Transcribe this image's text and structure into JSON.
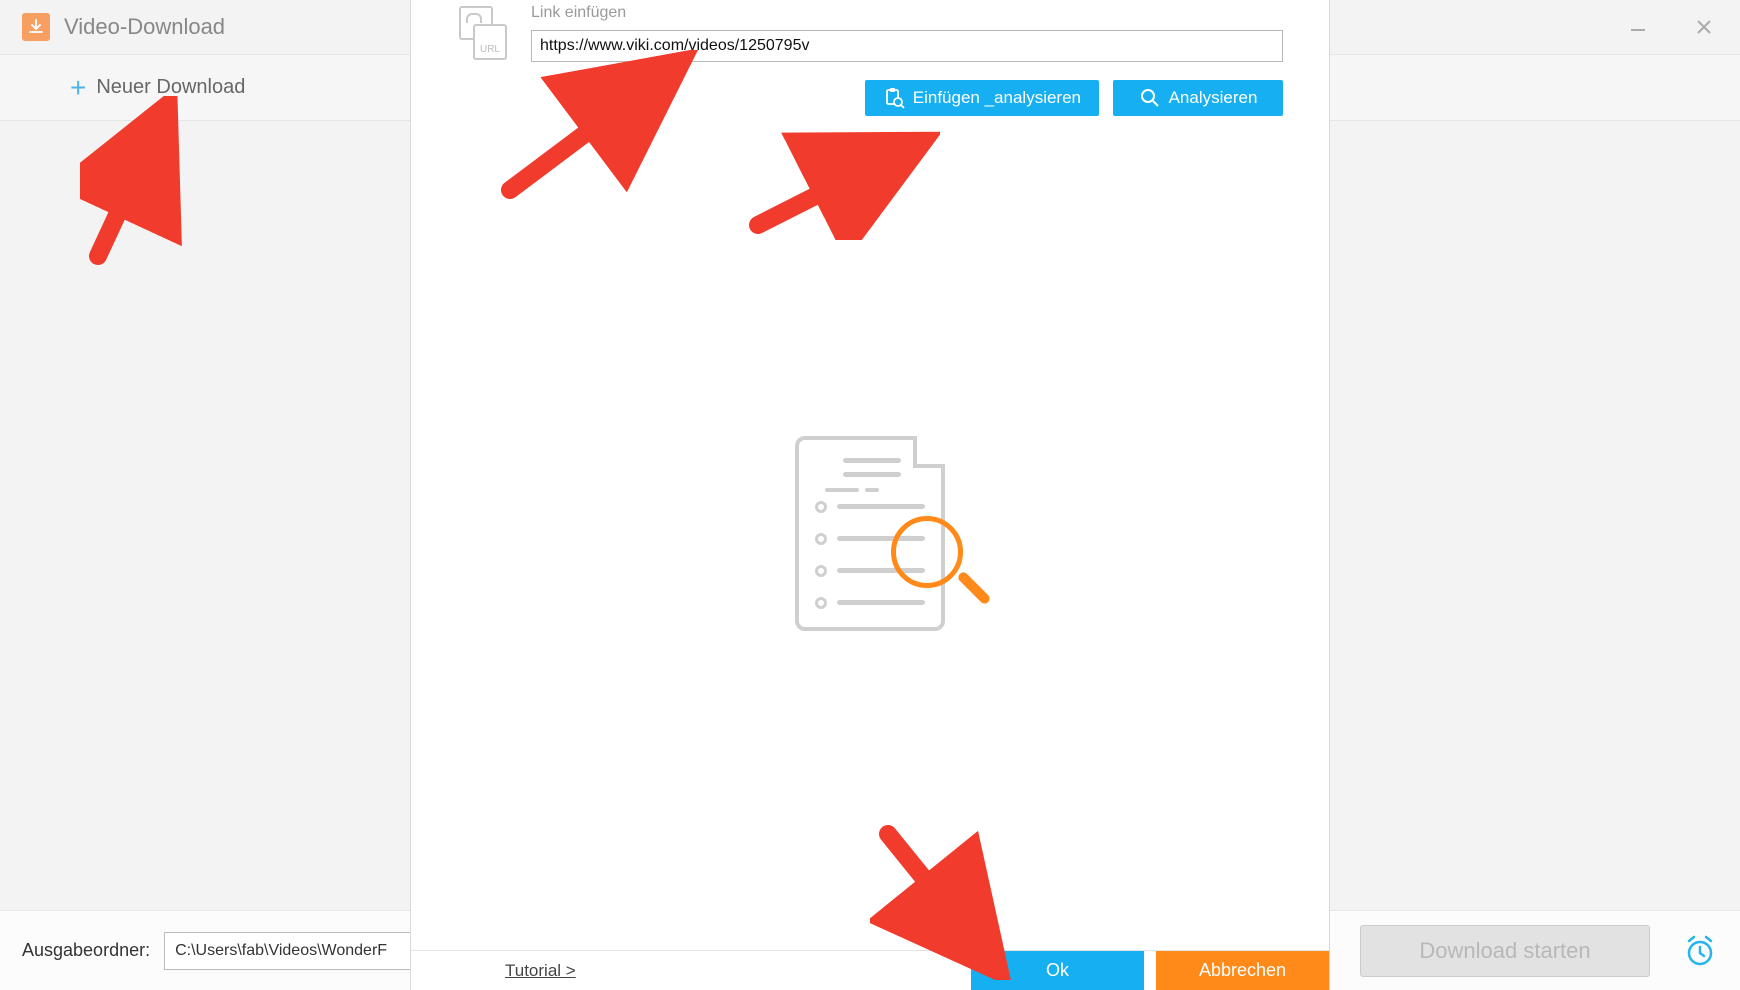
{
  "titlebar": {
    "title": "Video-Download"
  },
  "toolbar": {
    "new_download_label": "Neuer Download"
  },
  "dialog": {
    "link_label": "Link einfügen",
    "url_value": "https://www.viki.com/videos/1250795v",
    "url_icon_text": "URL",
    "paste_analyze_label": "Einfügen _analysieren",
    "analyze_label": "Analysieren",
    "tutorial_label": "Tutorial >",
    "ok_label": "Ok",
    "cancel_label": "Abbrechen"
  },
  "bottombar": {
    "output_folder_label": "Ausgabeordner:",
    "output_folder_path": "C:\\Users\\fab\\Videos\\WonderF",
    "start_label": "Download starten"
  },
  "colors": {
    "accent_blue": "#16aff2",
    "accent_orange": "#ff8a1a",
    "arrow_red": "#f03b2d"
  }
}
